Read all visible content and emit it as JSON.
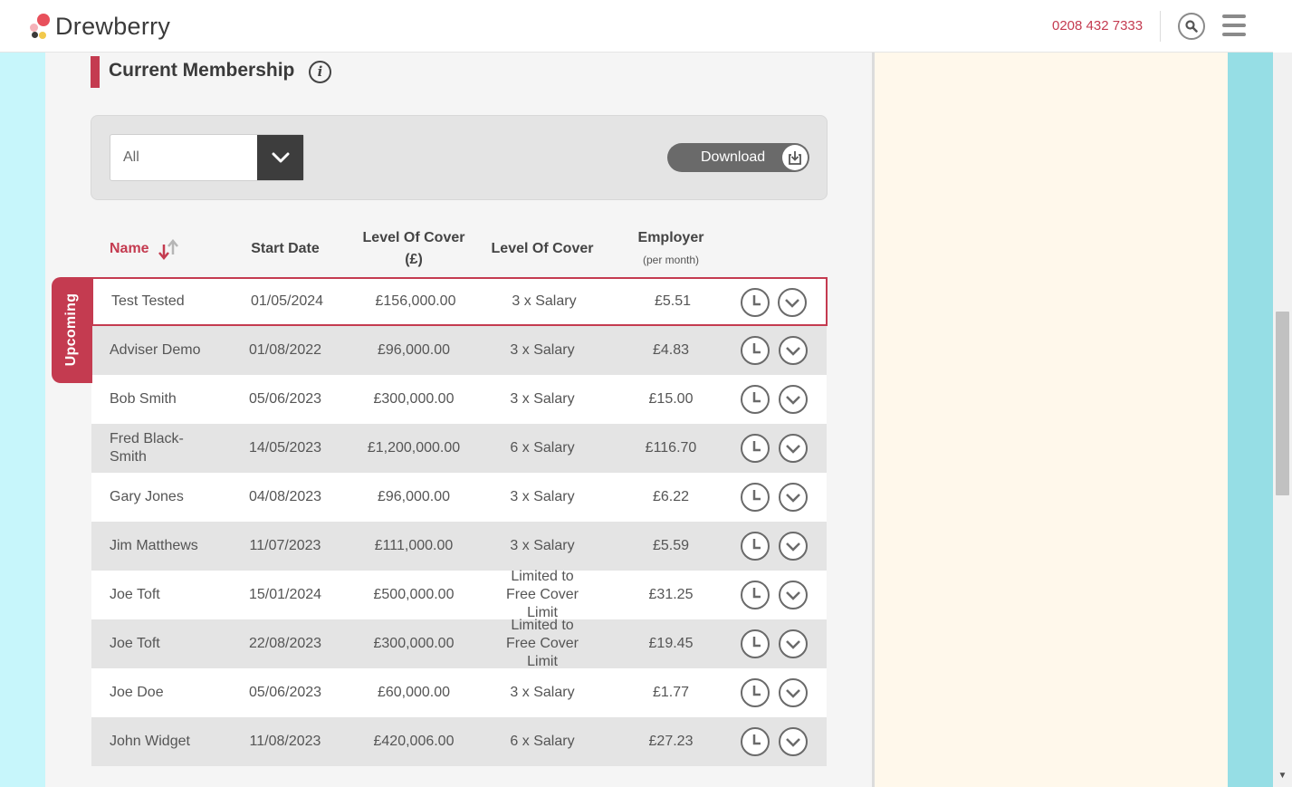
{
  "header": {
    "brand": "Drewberry",
    "phone": "0208 432 7333"
  },
  "section": {
    "title": "Current Membership"
  },
  "filter": {
    "selected": "All",
    "download_label": "Download"
  },
  "table": {
    "columns": {
      "name": "Name",
      "start_date": "Start Date",
      "cover_value": "Level Of Cover",
      "cover_value_sub": "(£)",
      "cover": "Level Of Cover",
      "employer": "Employer",
      "employer_sub": "(per month)"
    },
    "upcoming_label": "Upcoming",
    "rows": [
      {
        "name": "Test Tested",
        "start": "01/05/2024",
        "value": "£156,000.00",
        "cover": "3 x Salary",
        "employer": "£5.51"
      },
      {
        "name": "Adviser Demo",
        "start": "01/08/2022",
        "value": "£96,000.00",
        "cover": "3 x Salary",
        "employer": "£4.83"
      },
      {
        "name": "Bob Smith",
        "start": "05/06/2023",
        "value": "£300,000.00",
        "cover": "3 x Salary",
        "employer": "£15.00"
      },
      {
        "name": "Fred Black-Smith",
        "start": "14/05/2023",
        "value": "£1,200,000.00",
        "cover": "6 x Salary",
        "employer": "£116.70"
      },
      {
        "name": "Gary Jones",
        "start": "04/08/2023",
        "value": "£96,000.00",
        "cover": "3 x Salary",
        "employer": "£6.22"
      },
      {
        "name": "Jim Matthews",
        "start": "11/07/2023",
        "value": "£111,000.00",
        "cover": "3 x Salary",
        "employer": "£5.59"
      },
      {
        "name": "Joe Toft",
        "start": "15/01/2024",
        "value": "£500,000.00",
        "cover": "Limited to Free Cover Limit",
        "employer": "£31.25"
      },
      {
        "name": "Joe Toft",
        "start": "22/08/2023",
        "value": "£300,000.00",
        "cover": "Limited to Free Cover Limit",
        "employer": "£19.45"
      },
      {
        "name": "Joe Doe",
        "start": "05/06/2023",
        "value": "£60,000.00",
        "cover": "3 x Salary",
        "employer": "£1.77"
      },
      {
        "name": "John Widget",
        "start": "11/08/2023",
        "value": "£420,006.00",
        "cover": "6 x Salary",
        "employer": "£27.23"
      }
    ]
  },
  "colors": {
    "accent": "#c43b50",
    "row_alt": "#e4e4e4"
  },
  "icons": [
    "logo-dots-icon",
    "search-icon",
    "menu-icon",
    "info-icon",
    "chevron-down-icon",
    "download-icon",
    "sort-icon",
    "clock-icon",
    "expand-icon"
  ]
}
